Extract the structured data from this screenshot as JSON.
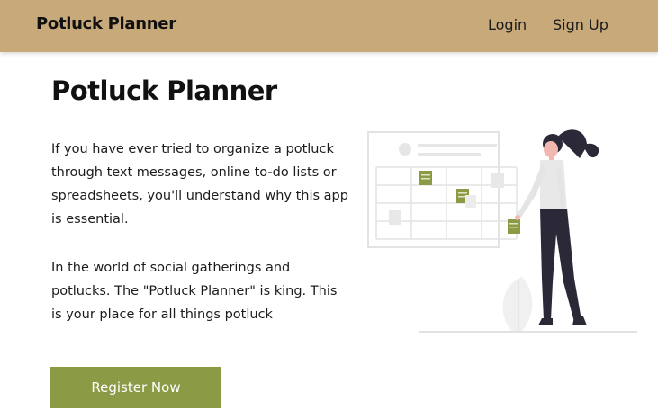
{
  "navbar": {
    "brand": "Potluck Planner",
    "links": {
      "login": "Login",
      "signup": "Sign Up"
    }
  },
  "hero": {
    "title": "Potluck Planner",
    "paragraph_1": "If you have ever tried to organize a potluck through text messages, online to-do lists or spreadsheets, you'll understand why this app is essential.",
    "paragraph_2": "In the world of social gatherings and potlucks. The \"Potluck Planner\" is king. This is your place for all things potluck",
    "cta_label": "Register Now"
  },
  "colors": {
    "navbar_bg": "#c8a97a",
    "accent_green": "#8a9a45",
    "text": "#111111"
  },
  "illustration": {
    "name": "woman-with-calendar-board-illustration"
  }
}
